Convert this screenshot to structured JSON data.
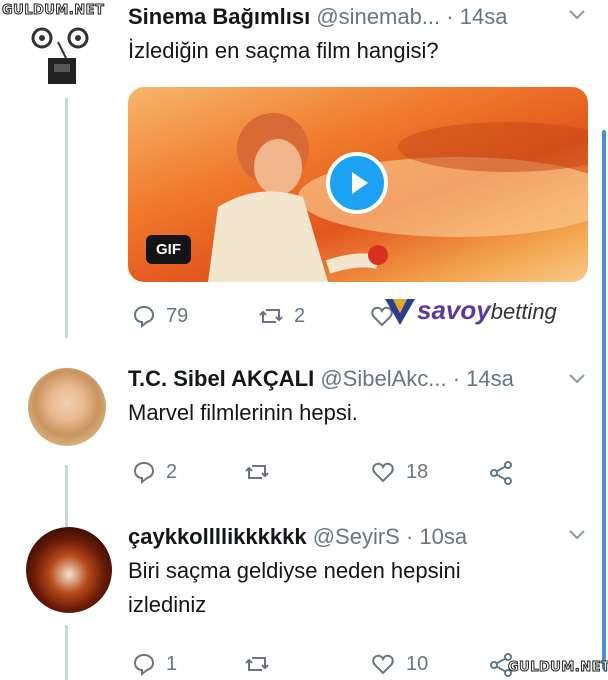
{
  "watermark_top": "GULDUM.NET",
  "watermark_bottom": "GULDUM.NET",
  "savoy": {
    "brand": "savoy",
    "suffix": "betting"
  },
  "tweets": [
    {
      "name": "Sinema Bağımlısı",
      "handle": "@sinemab...",
      "dot": "·",
      "time": "14sa",
      "text": "İzlediğin en saçma film hangisi?",
      "media_badge": "GIF",
      "replies": "79",
      "retweets": "2",
      "likes": ""
    },
    {
      "name": "T.C. Sibel AKÇALI",
      "handle": "@SibelAkc...",
      "dot": "·",
      "time": "14sa",
      "text": "Marvel filmlerinin hepsi.",
      "replies": "2",
      "retweets": "",
      "likes": "18"
    },
    {
      "name": "çaykkollllikkkkkk",
      "handle": "@SeyirS",
      "dot": "·",
      "time": "10sa",
      "text_line1": "Biri saçma geldiyse neden hepsini",
      "text_line2": "izlediniz",
      "replies": "1",
      "retweets": "",
      "likes": "10"
    }
  ]
}
